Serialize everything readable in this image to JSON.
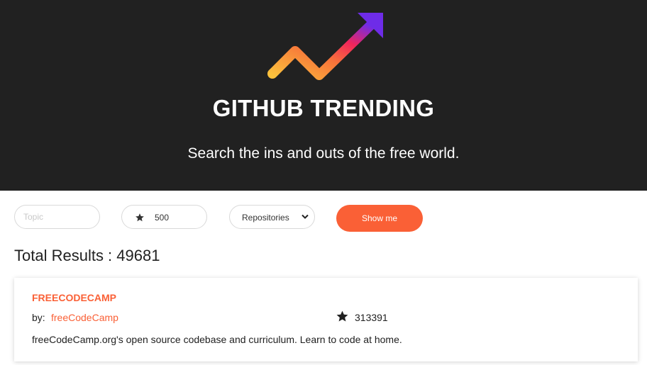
{
  "hero": {
    "title": "GITHUB TRENDING",
    "subtitle": "Search the ins and outs of the free world."
  },
  "search": {
    "topic_placeholder": "Topic",
    "topic_value": "",
    "stars_value": "500",
    "type_selected": "Repositories",
    "type_options": [
      "Repositories"
    ],
    "submit_label": "Show me"
  },
  "results": {
    "label": "Total Results :",
    "count": "49681"
  },
  "repos": [
    {
      "name": "FREECODECAMP",
      "by_label": "by:",
      "owner": "freeCodeCamp",
      "stars": "313391",
      "description": "freeCodeCamp.org's open source codebase and curriculum. Learn to code at home."
    }
  ],
  "colors": {
    "accent": "#fa6036",
    "hero_bg": "#212121",
    "logo_gradient": [
      "#fbc13c",
      "#f7733a",
      "#f0255b",
      "#6e2ce8"
    ]
  },
  "icons": {
    "logo": "trending-up-arrow",
    "stars": "star-icon"
  }
}
